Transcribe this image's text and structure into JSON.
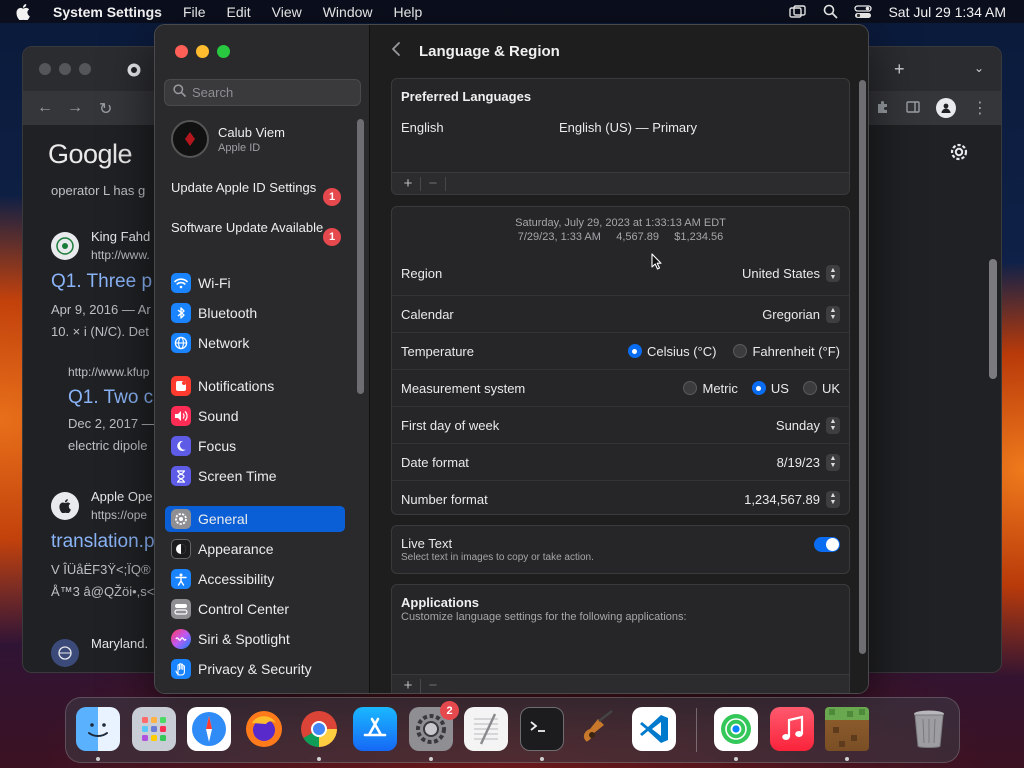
{
  "menubar": {
    "app_name": "System Settings",
    "menus": [
      "File",
      "Edit",
      "View",
      "Window",
      "Help"
    ],
    "clock": "Sat Jul 29  1:34 AM"
  },
  "browser": {
    "logo": "Google",
    "results": [
      {
        "snippet_top": "operator L has g"
      },
      {
        "site": "King Fahd",
        "url": "http://www.",
        "title": "Q1. Three p",
        "meta": "Apr 9, 2016 — Ar",
        "snippet": "10. × i (N/C). Det"
      },
      {
        "url": "http://www.kfup",
        "title": "Q1. Two c",
        "meta": "Dec 2, 2017 —",
        "snippet": "electric dipole"
      },
      {
        "site": "Apple Ope",
        "url": "https://ope",
        "title": "translation.p",
        "snippet": "V ÎÜåËF3Ÿ<;ÏQ®",
        "snippet2": "Å™3 â@QŽöi•,s<"
      },
      {
        "site": "Maryland."
      }
    ]
  },
  "sidebar": {
    "search_placeholder": "Search",
    "account": {
      "name": "Calub Viem",
      "subtitle": "Apple ID"
    },
    "notices": [
      {
        "label": "Update Apple ID Settings",
        "badge": "1"
      },
      {
        "label": "Software Update Available",
        "badge": "1"
      }
    ],
    "items": [
      {
        "label": "Wi-Fi",
        "icon": "wifi-icon",
        "color": "#1a84ff"
      },
      {
        "label": "Bluetooth",
        "icon": "bluetooth-icon",
        "color": "#1a84ff"
      },
      {
        "label": "Network",
        "icon": "globe-icon",
        "color": "#1a84ff"
      },
      {
        "label": "Notifications",
        "icon": "bell-icon",
        "color": "#ff3b30"
      },
      {
        "label": "Sound",
        "icon": "speaker-icon",
        "color": "#ff2d55"
      },
      {
        "label": "Focus",
        "icon": "moon-icon",
        "color": "#5e5ce6"
      },
      {
        "label": "Screen Time",
        "icon": "hourglass-icon",
        "color": "#5e5ce6"
      },
      {
        "label": "General",
        "icon": "gear-icon",
        "color": "#8e8e93"
      },
      {
        "label": "Appearance",
        "icon": "appearance-icon",
        "color": "#1c1c1e"
      },
      {
        "label": "Accessibility",
        "icon": "accessibility-icon",
        "color": "#1a84ff"
      },
      {
        "label": "Control Center",
        "icon": "control-center-icon",
        "color": "#8e8e93"
      },
      {
        "label": "Siri & Spotlight",
        "icon": "siri-icon",
        "color": "#bf5af2"
      },
      {
        "label": "Privacy & Security",
        "icon": "hand-icon",
        "color": "#1a84ff"
      }
    ]
  },
  "content": {
    "title": "Language & Region",
    "preferred": {
      "heading": "Preferred Languages",
      "language": "English",
      "detail": "English (US) — Primary"
    },
    "sample": {
      "line1": "Saturday, July 29, 2023 at 1:33:13 AM EDT",
      "line2": "7/29/23, 1:33 AM     4,567.89     $1,234.56"
    },
    "rows": {
      "region": {
        "label": "Region",
        "value": "United States"
      },
      "calendar": {
        "label": "Calendar",
        "value": "Gregorian"
      },
      "temperature": {
        "label": "Temperature",
        "options": [
          "Celsius (°C)",
          "Fahrenheit (°F)"
        ],
        "selected": "Celsius (°C)"
      },
      "measurement": {
        "label": "Measurement system",
        "options": [
          "Metric",
          "US",
          "UK"
        ],
        "selected": "US"
      },
      "first_day": {
        "label": "First day of week",
        "value": "Sunday"
      },
      "date_format": {
        "label": "Date format",
        "value": "8/19/23"
      },
      "number_format": {
        "label": "Number format",
        "value": "1,234,567.89"
      }
    },
    "live_text": {
      "label": "Live Text",
      "description": "Select text in images to copy or take action.",
      "enabled": true
    },
    "applications": {
      "heading": "Applications",
      "description": "Customize language settings for the following applications:"
    }
  },
  "dock": {
    "apps": [
      "Finder",
      "Launchpad",
      "Safari",
      "Firefox",
      "Chrome",
      "App Store",
      "System Settings",
      "TextEdit",
      "Terminal",
      "GarageBand",
      "Visual Studio Code",
      "Find My",
      "Music",
      "Minecraft",
      "Trash"
    ],
    "system_settings_badge": "2"
  },
  "colors": {
    "accent": "#0a6cf0",
    "selection": "#0a5fd6",
    "badge": "#e5484d"
  }
}
